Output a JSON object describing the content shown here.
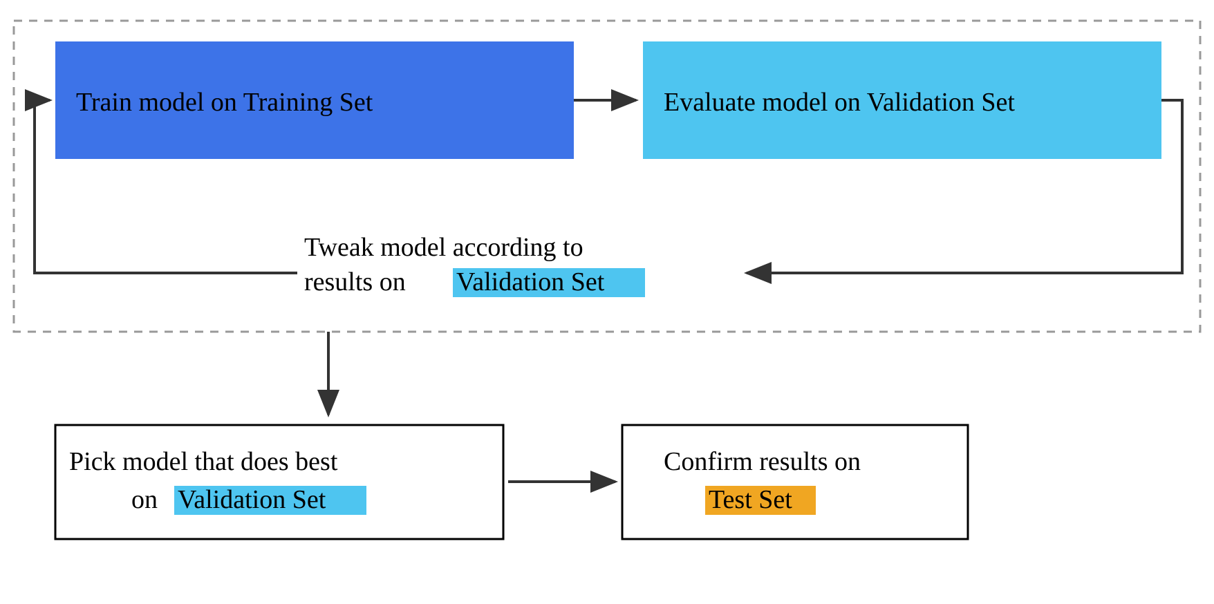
{
  "colors": {
    "trainBox": "#3D73E8",
    "validateBox": "#4EC5F0",
    "validationHighlight": "#4EC5F0",
    "testHighlight": "#F0A622",
    "dashedBorder": "#999999",
    "solidBorder": "#000000",
    "arrow": "#333333"
  },
  "boxes": {
    "train": "Train model on Training Set",
    "evaluate": "Evaluate model on Validation Set",
    "tweak_line1": "Tweak model according to",
    "tweak_line2_pre": "results on",
    "tweak_highlight": "Validation Set",
    "pick_line1": "Pick model that does best",
    "pick_line2_pre": "on",
    "pick_highlight": "Validation Set",
    "confirm_line1": "Confirm results on",
    "confirm_highlight": "Test Set"
  }
}
